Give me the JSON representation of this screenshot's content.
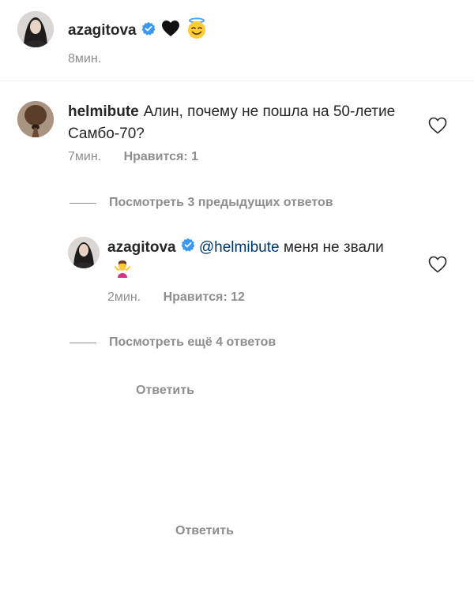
{
  "caption": {
    "username": "azagitova",
    "verified": true,
    "emoji": [
      "black-heart",
      "smiling-face-with-halo"
    ],
    "time": "8мин."
  },
  "comment": {
    "username": "helmibute",
    "text": "Алин, почему не пошла на 50-летие Самбо-70?",
    "time": "7мин.",
    "likes": "Нравится: 1",
    "reply": "Ответить"
  },
  "view_previous": "Посмотреть 3 предыдущих ответов",
  "reply": {
    "username": "azagitova",
    "verified": true,
    "mention": "@helmibute",
    "text": "меня не звали",
    "emoji": "person-shrugging",
    "time": "2мин.",
    "likes": "Нравится: 12",
    "reply": "Ответить"
  },
  "view_more": "Посмотреть ещё 4 ответов",
  "colors": {
    "text": "#262626",
    "secondary": "#8e8e8e",
    "verified": "#3897f0",
    "mention": "#00376b"
  }
}
